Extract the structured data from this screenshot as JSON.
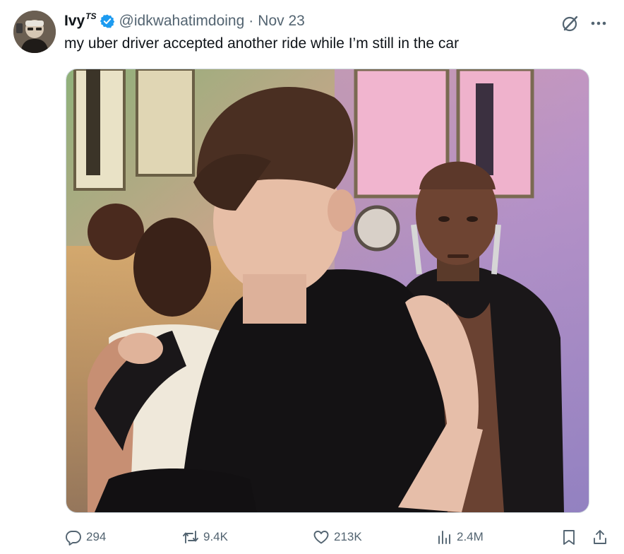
{
  "author": {
    "display_name": "Ivy",
    "name_badge": "TS",
    "handle": "@idkwahatimdoing",
    "separator": "·",
    "date": "Nov 23",
    "verified": true
  },
  "tweet": {
    "text": "my uber driver accepted another ride while I’m still in the car"
  },
  "stats": {
    "replies": "294",
    "retweets": "9.4K",
    "likes": "213K",
    "views": "2.4M"
  },
  "icons": {
    "verified": "verified-badge-icon",
    "grok": "grok-icon",
    "more": "more-icon",
    "reply": "reply-icon",
    "retweet": "retweet-icon",
    "like": "heart-icon",
    "views": "bar-chart-icon",
    "bookmark": "bookmark-icon",
    "share": "share-icon"
  },
  "colors": {
    "verified": "#1d9bf0",
    "muted": "#536471",
    "text": "#0f1419"
  }
}
